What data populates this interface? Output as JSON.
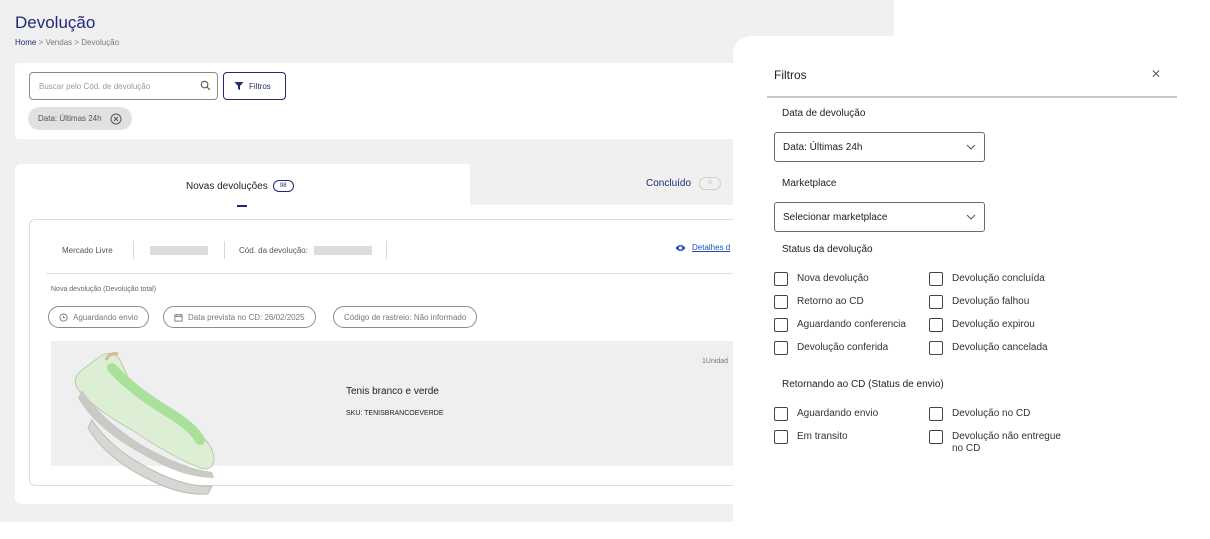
{
  "header": {
    "title": "Devolução",
    "breadcrumb": {
      "home": "Home",
      "rest": " > Vendas > Devolução"
    }
  },
  "search": {
    "placeholder": "Buscar pelo Cód. de devolução"
  },
  "filters_button": {
    "label": "Filtros"
  },
  "active_chip": {
    "label": "Data: Últimas 24h"
  },
  "tabs": [
    {
      "label": "Novas devoluções",
      "count": "98"
    },
    {
      "label": "Concluído",
      "count": "0"
    }
  ],
  "order": {
    "marketplace": "Mercado Livre",
    "code_label": "Cód. da devolução:",
    "details_link": "Detalhes d",
    "type_label": "Nova devolução (Devolução total)",
    "status_pill": "Aguardando envio",
    "date_pill": "Data prevista no CD: 26/02/2025",
    "tracking_pill": "Código de rastreio: Não informado",
    "product": {
      "name": "Tenis branco e verde",
      "sku": "SKU: TENISBRANCOEVERDE",
      "qty": "1Unidad"
    }
  },
  "drawer": {
    "title": "Filtros",
    "date_section": "Data de devolução",
    "date_value": "Data: Últimas 24h",
    "marketplace_section": "Marketplace",
    "marketplace_value": "Selecionar marketplace",
    "status_section": "Status da devolução",
    "status_options": [
      "Nova devolução",
      "Devolução concluída",
      "Retorno ao CD",
      "Devolução falhou",
      "Aguardando conferencia",
      "Devolução expirou",
      "Devolução conferida",
      "Devolução cancelada"
    ],
    "shipping_section": "Retornando ao CD (Status de envio)",
    "shipping_options": [
      "Aguardando envio",
      "Devolução no CD",
      "Em transito",
      "Devolução não entregue no CD"
    ]
  },
  "colors": {
    "primary": "#1e2a78",
    "link": "#1e4fb8",
    "bg": "#f0f0f1"
  }
}
